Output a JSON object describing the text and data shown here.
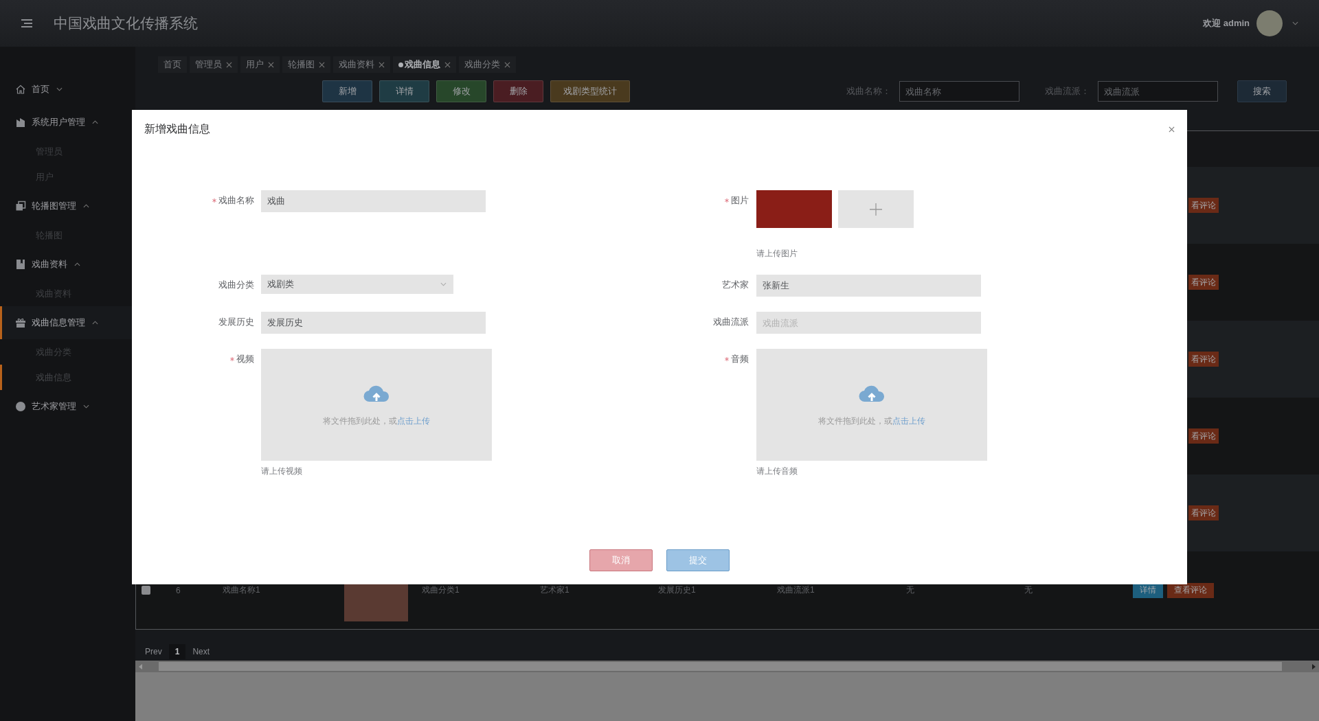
{
  "header": {
    "title": "中国戏曲文化传播系统",
    "greeting": "欢迎 admin"
  },
  "sidebar": {
    "items": [
      {
        "label": "首页",
        "expanded": false,
        "selected": false
      },
      {
        "label": "系统用户管理",
        "expanded": true,
        "selected": false,
        "children": [
          {
            "label": "管理员",
            "selected": false
          },
          {
            "label": "用户",
            "selected": false
          }
        ]
      },
      {
        "label": "轮播图管理",
        "expanded": true,
        "selected": false,
        "children": [
          {
            "label": "轮播图",
            "selected": false
          }
        ]
      },
      {
        "label": "戏曲资料",
        "expanded": true,
        "selected": false,
        "children": [
          {
            "label": "戏曲资料",
            "selected": false
          }
        ]
      },
      {
        "label": "戏曲信息管理",
        "expanded": true,
        "selected": true,
        "children": [
          {
            "label": "戏曲分类",
            "selected": false
          },
          {
            "label": "戏曲信息",
            "selected": true
          }
        ]
      },
      {
        "label": "艺术家管理",
        "expanded": false,
        "selected": false
      }
    ]
  },
  "tabs": [
    {
      "label": "首页",
      "closable": false,
      "selected": false
    },
    {
      "label": "管理员",
      "closable": true,
      "selected": false
    },
    {
      "label": "用户",
      "closable": true,
      "selected": false
    },
    {
      "label": "轮播图",
      "closable": true,
      "selected": false
    },
    {
      "label": "戏曲资料",
      "closable": true,
      "selected": false
    },
    {
      "label": "戏曲信息",
      "closable": true,
      "selected": true
    },
    {
      "label": "戏曲分类",
      "closable": true,
      "selected": false
    }
  ],
  "toolbar": {
    "buttons": [
      {
        "label": "新增",
        "color": "#1e3444"
      },
      {
        "label": "详情",
        "color": "#1f3c44"
      },
      {
        "label": "修改",
        "color": "#27472a"
      },
      {
        "label": "删除",
        "color": "#4a1d22"
      },
      {
        "label": "戏剧类型统计",
        "color": "#4a3a1e"
      }
    ],
    "search": [
      {
        "label": "戏曲名称：",
        "placeholder": "戏曲名称"
      },
      {
        "label": "戏曲流派：",
        "placeholder": "戏曲流派"
      }
    ],
    "search_button": "搜索"
  },
  "table": {
    "rows": [
      {
        "kind": "covered",
        "comment_button": "看评论"
      },
      {
        "kind": "covered",
        "comment_button": "看评论"
      },
      {
        "kind": "covered",
        "comment_button": "看评论"
      },
      {
        "kind": "covered",
        "comment_button": "看评论"
      },
      {
        "kind": "covered",
        "comment_button": "看评论"
      },
      {
        "kind": "full",
        "checked": false,
        "cells": [
          "6",
          "戏曲名称1",
          "戏曲分类1",
          "艺术家1",
          "发展历史1",
          "戏曲流派1",
          "无",
          "无"
        ],
        "detail_button": "详情",
        "comment_button": "查看评论"
      }
    ]
  },
  "pagination": {
    "prev": "Prev",
    "pages": [
      {
        "label": "1",
        "selected": true
      }
    ],
    "next": "Next"
  },
  "dialog": {
    "title": "新增戏曲信息",
    "fields": [
      {
        "kind": "text",
        "label": "戏曲名称",
        "required": true,
        "value": "戏曲"
      },
      {
        "kind": "image",
        "label": "图片",
        "required": true,
        "hint": "请上传图片"
      },
      {
        "kind": "select",
        "label": "戏曲分类",
        "required": false,
        "value": "戏剧类"
      },
      {
        "kind": "text",
        "label": "艺术家",
        "required": false,
        "value": "张新生"
      },
      {
        "kind": "text",
        "label": "发展历史",
        "required": false,
        "value": "发展历史"
      },
      {
        "kind": "text",
        "label": "戏曲流派",
        "required": false,
        "placeholder": "戏曲流派"
      },
      {
        "kind": "upload",
        "label": "视频",
        "required": true,
        "drop_text": "将文件拖到此处，或",
        "link": "点击上传",
        "hint": "请上传视频"
      },
      {
        "kind": "upload",
        "label": "音频",
        "required": true,
        "drop_text": "将文件拖到此处，或",
        "link": "点击上传",
        "hint": "请上传音频"
      }
    ],
    "buttons": [
      {
        "kind": "cancel",
        "label": "取消"
      },
      {
        "kind": "submit",
        "label": "提交"
      }
    ]
  }
}
